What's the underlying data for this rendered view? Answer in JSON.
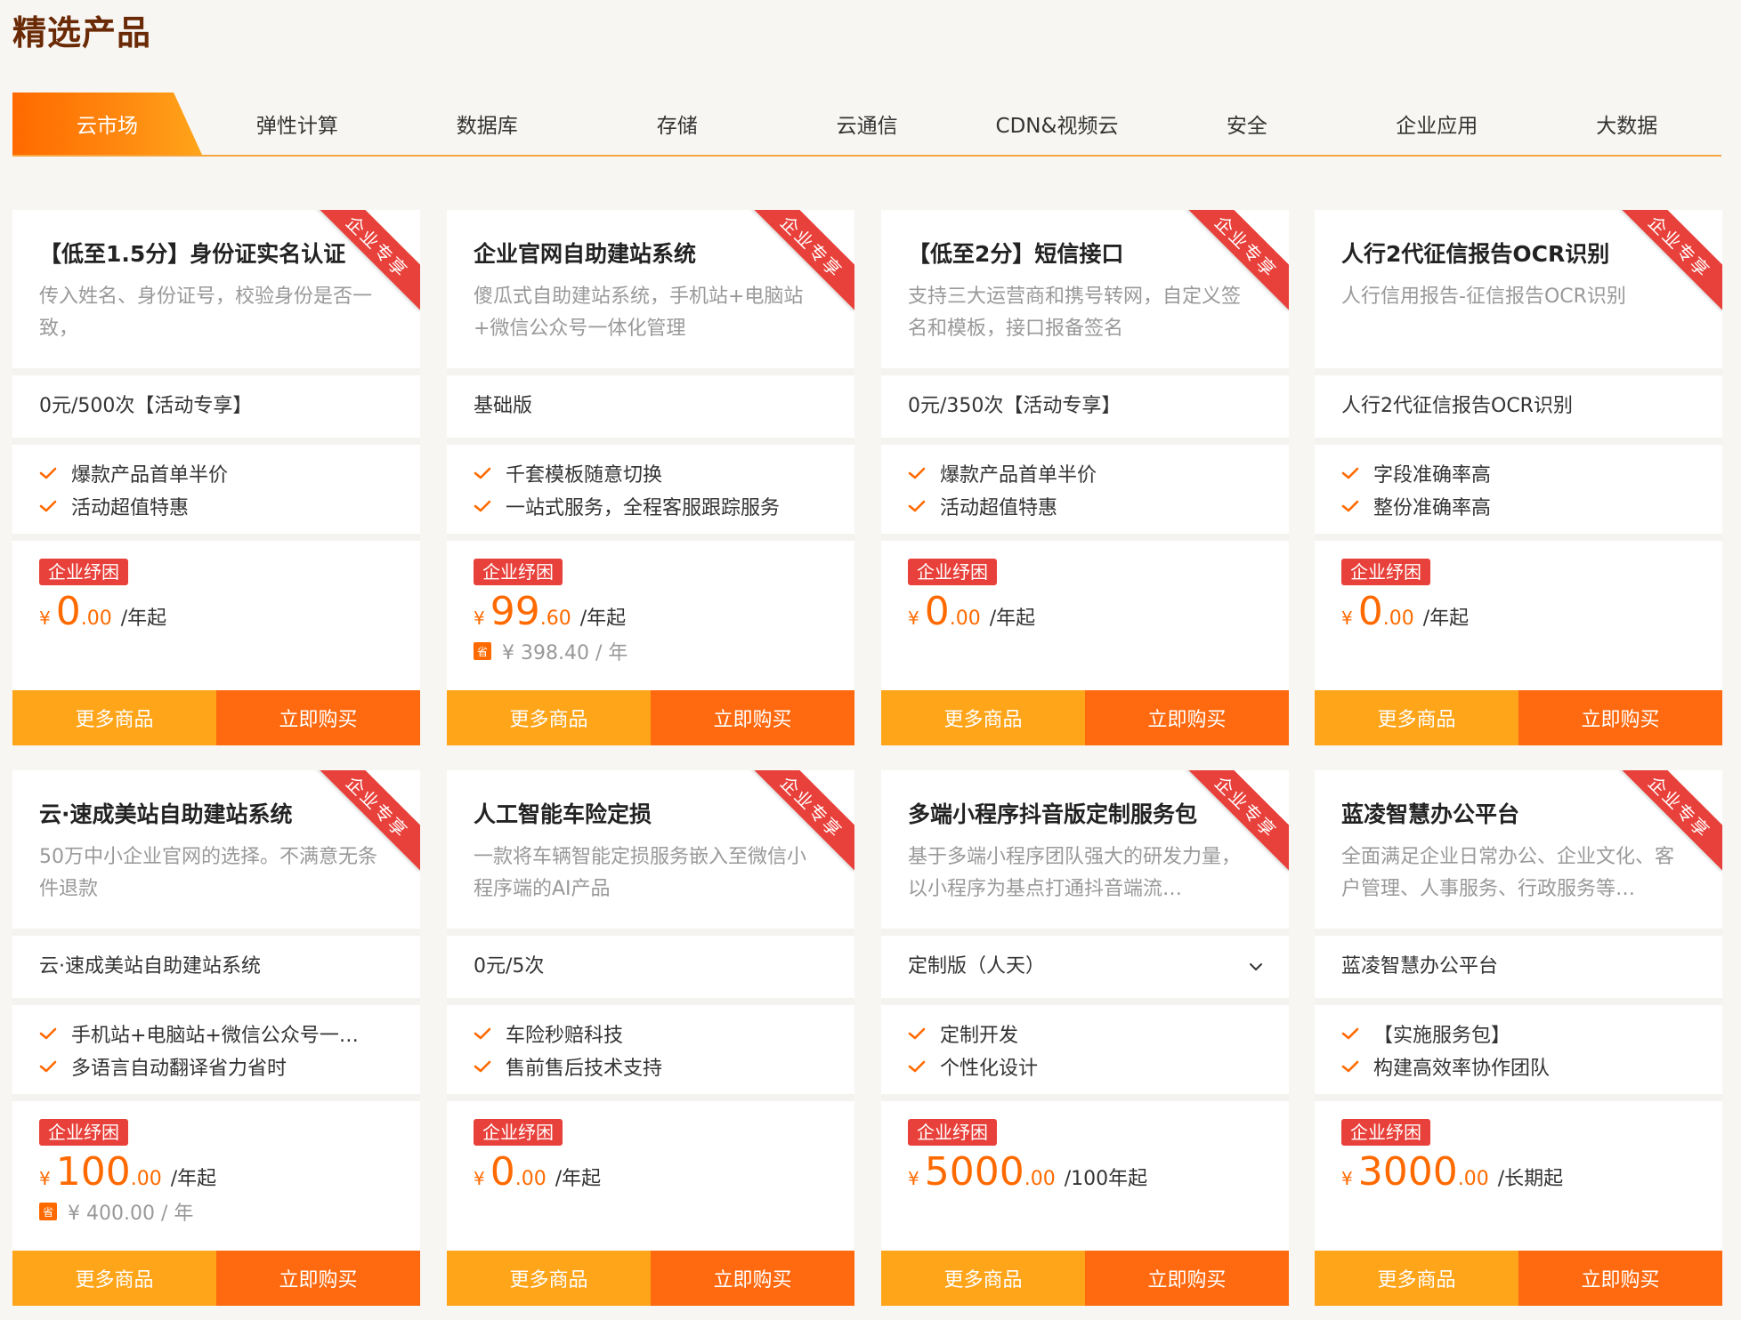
{
  "section_title": "精选产品",
  "tabs": [
    "云市场",
    "弹性计算",
    "数据库",
    "存储",
    "云通信",
    "CDN&视频云",
    "安全",
    "企业应用",
    "大数据"
  ],
  "ribbon_label": "企业专享",
  "badge_label": "企业纾困",
  "more_label": "更多商品",
  "buy_label": "立即购买",
  "currency": "¥",
  "save_icon_text": "省",
  "colors": {
    "accent": "#ff6a00",
    "ribbon": "#e8403a",
    "more_btn": "#ffa51a",
    "title": "#6b2a06"
  },
  "cards": [
    {
      "title": "【低至1.5分】身份证实名认证",
      "desc": "传入姓名、身份证号，校验身份是否一致，",
      "spec": "0元/500次【活动专享】",
      "features": [
        "爆款产品首单半价",
        "活动超值特惠"
      ],
      "price_int": "0",
      "price_dec": ".00",
      "unit": "/年起"
    },
    {
      "title": "企业官网自助建站系统",
      "desc": "傻瓜式自助建站系统，手机站+电脑站+微信公众号一体化管理",
      "spec": "基础版",
      "features": [
        "千套模板随意切换",
        "一站式服务，全程客服跟踪服务"
      ],
      "price_int": "99",
      "price_dec": ".60",
      "unit": "/年起",
      "original": "¥ 398.40 / 年"
    },
    {
      "title": "【低至2分】短信接口",
      "desc": "支持三大运营商和携号转网，自定义签名和模板，接口报备签名",
      "spec": "0元/350次【活动专享】",
      "features": [
        "爆款产品首单半价",
        "活动超值特惠"
      ],
      "price_int": "0",
      "price_dec": ".00",
      "unit": "/年起"
    },
    {
      "title": "人行2代征信报告OCR识别",
      "desc": "人行信用报告-征信报告OCR识别",
      "spec": "人行2代征信报告OCR识别",
      "features": [
        "字段准确率高",
        "整份准确率高"
      ],
      "price_int": "0",
      "price_dec": ".00",
      "unit": "/年起"
    },
    {
      "title": "云·速成美站自助建站系统",
      "desc": "50万中小企业官网的选择。不满意无条件退款",
      "spec": "云·速成美站自助建站系统",
      "features": [
        "手机站+电脑站+微信公众号一…",
        "多语言自动翻译省力省时"
      ],
      "price_int": "100",
      "price_dec": ".00",
      "unit": "/年起",
      "original": "¥ 400.00 / 年"
    },
    {
      "title": "人工智能车险定损",
      "desc": "一款将车辆智能定损服务嵌入至微信小程序端的AI产品",
      "spec": "0元/5次",
      "features": [
        "车险秒赔科技",
        "售前售后技术支持"
      ],
      "price_int": "0",
      "price_dec": ".00",
      "unit": "/年起"
    },
    {
      "title": "多端小程序抖音版定制服务包",
      "desc": "基于多端小程序团队强大的研发力量，以小程序为基点打通抖音端流…",
      "spec": "定制版（人天）",
      "dropdown": true,
      "features": [
        "定制开发",
        "个性化设计"
      ],
      "price_int": "5000",
      "price_dec": ".00",
      "unit": "/100年起"
    },
    {
      "title": "蓝凌智慧办公平台",
      "desc": "全面满足企业日常办公、企业文化、客户管理、人事服务、行政服务等…",
      "spec": "蓝凌智慧办公平台",
      "features": [
        "【实施服务包】",
        "构建高效率协作团队"
      ],
      "price_int": "3000",
      "price_dec": ".00",
      "unit": "/长期起"
    }
  ]
}
